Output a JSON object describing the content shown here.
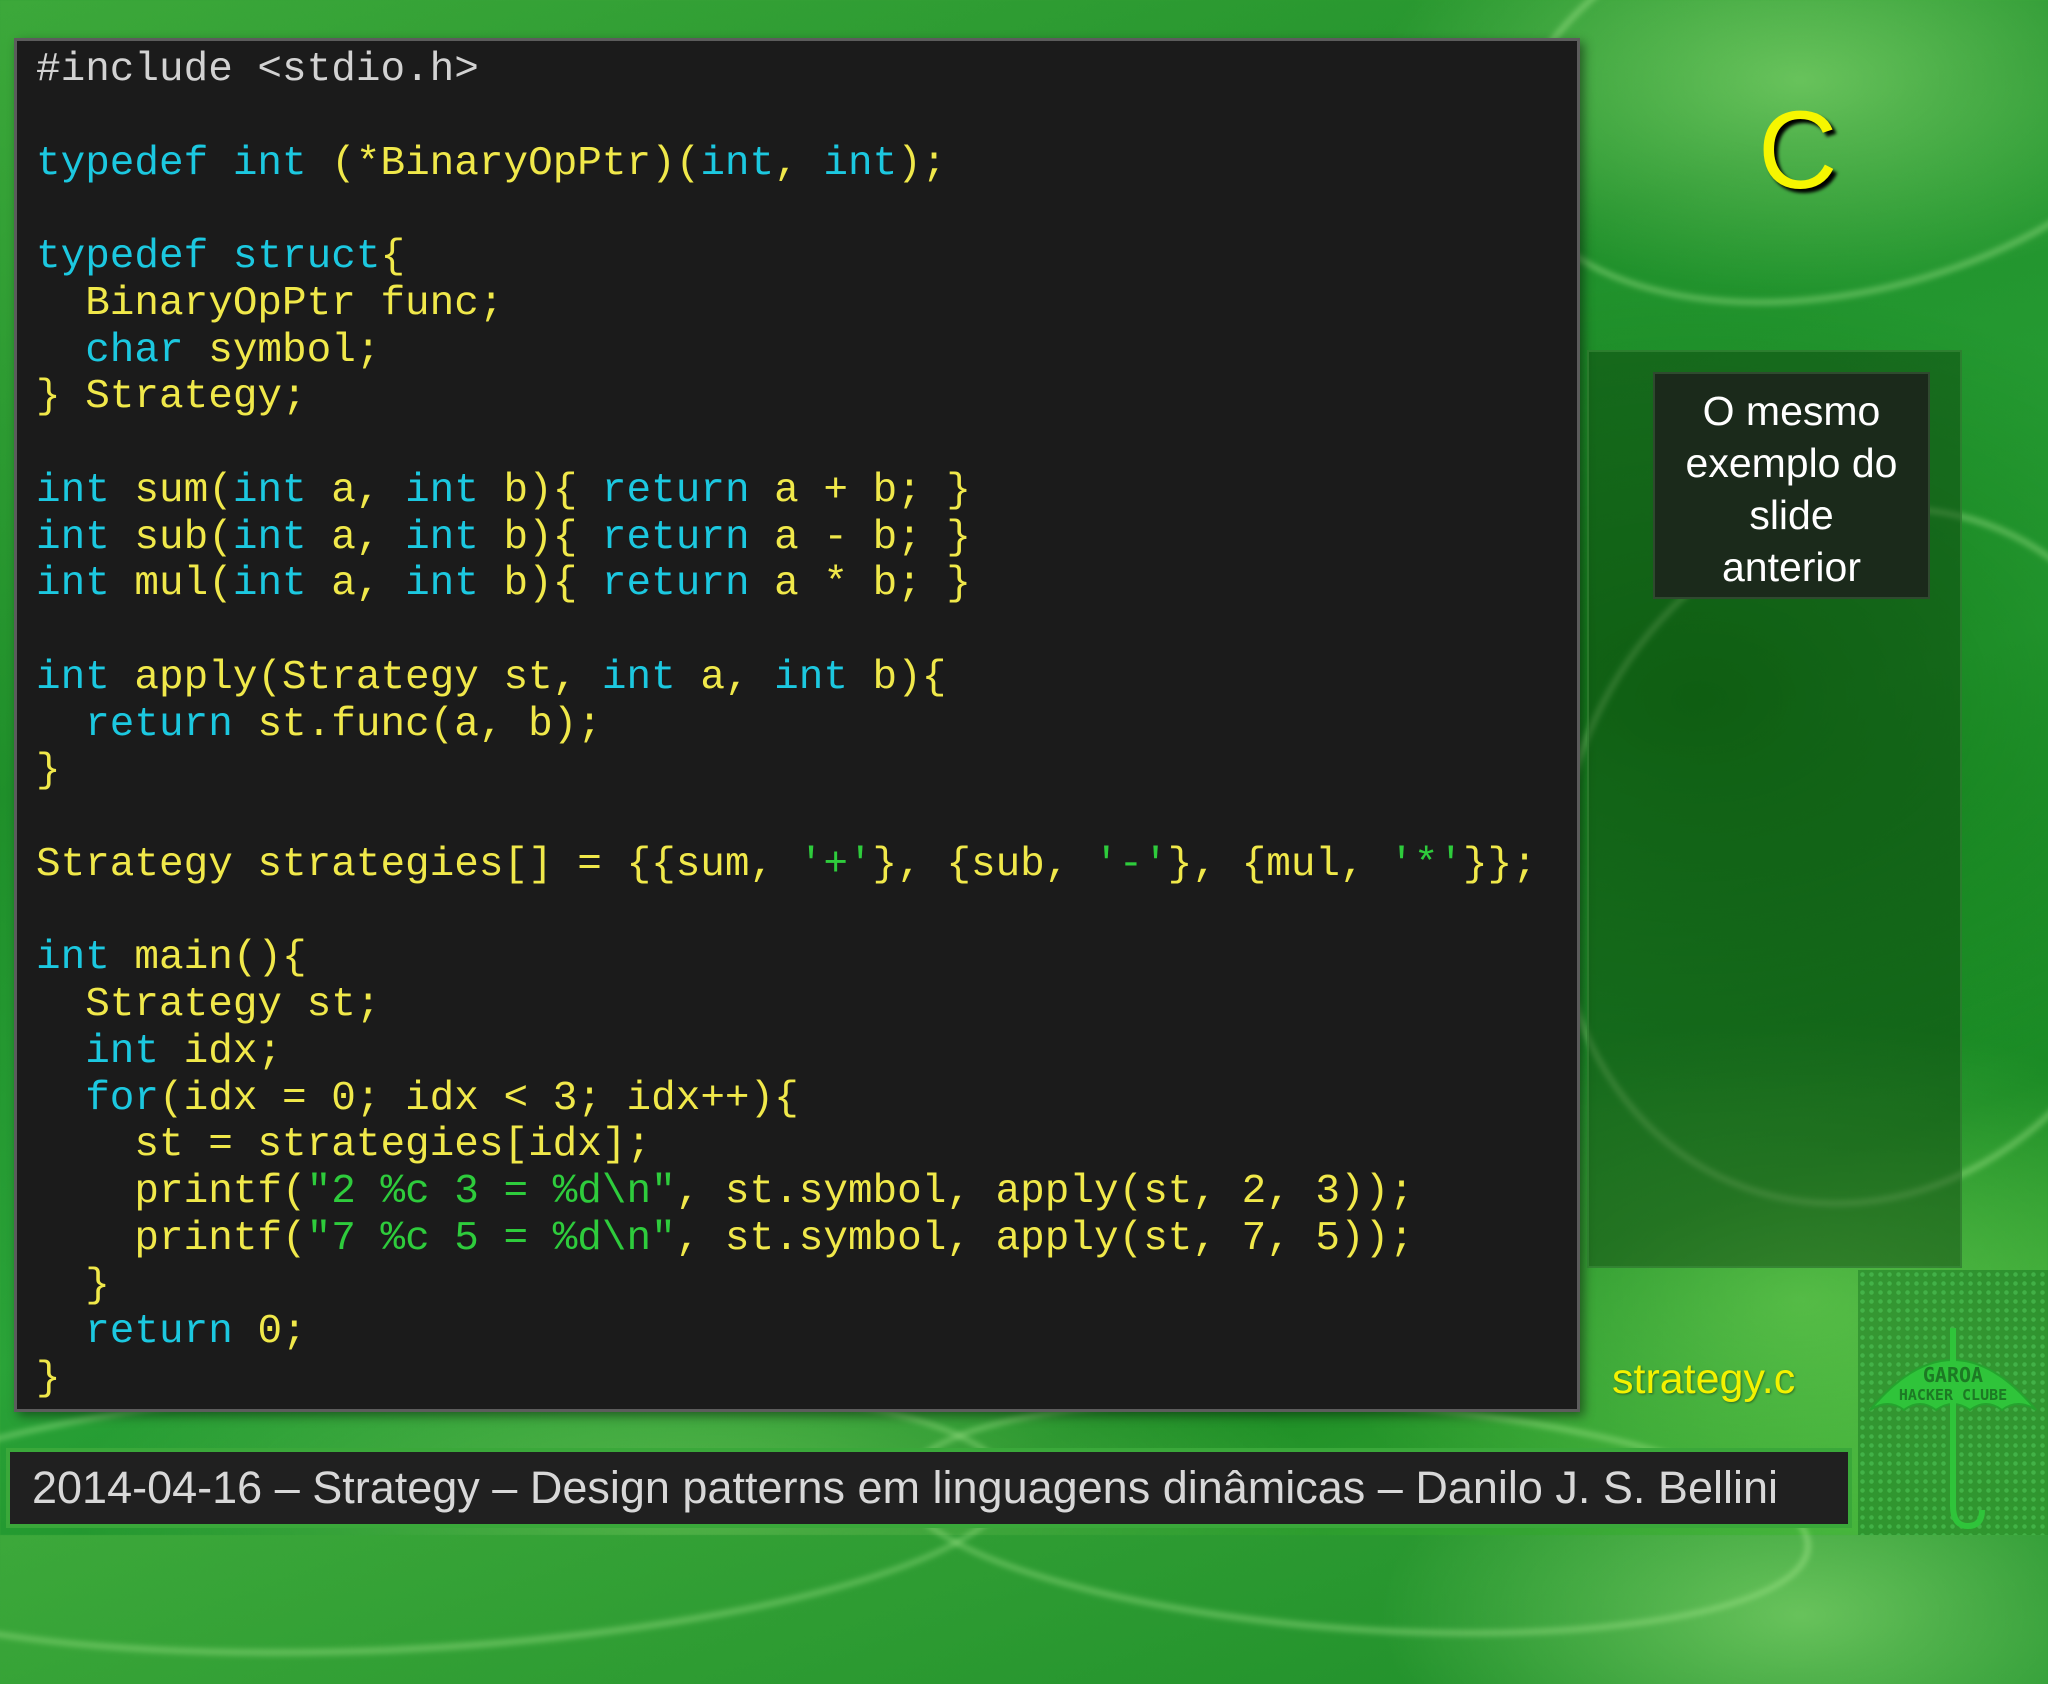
{
  "slide": {
    "language_title": "C",
    "note": [
      "O mesmo",
      "exemplo do",
      "slide",
      "anterior"
    ],
    "filename": "strategy.c",
    "footer": "2014-04-16 – Strategy – Design patterns em linguagens dinâmicas – Danilo J. S. Bellini",
    "logo_text": [
      "GAROA",
      "HACKER CLUBE"
    ]
  },
  "colors": {
    "keyword": "#1cc8e0",
    "identifier": "#f0e84a",
    "string": "#2ecc3c",
    "preprocessor": "#d2d2d2",
    "code_background": "#1b1b1b",
    "title": "#f6f600"
  },
  "code_lines": [
    [
      [
        "pp",
        "#include <stdio.h>"
      ]
    ],
    [],
    [
      [
        "kw",
        "typedef int"
      ],
      [
        "plain",
        " (*BinaryOpPtr)("
      ],
      [
        "kw",
        "int"
      ],
      [
        "plain",
        ", "
      ],
      [
        "kw",
        "int"
      ],
      [
        "plain",
        ");"
      ]
    ],
    [],
    [
      [
        "kw",
        "typedef struct"
      ],
      [
        "plain",
        "{"
      ]
    ],
    [
      [
        "plain",
        "  BinaryOpPtr func;"
      ]
    ],
    [
      [
        "kw",
        "  char"
      ],
      [
        "plain",
        " symbol;"
      ]
    ],
    [
      [
        "plain",
        "} Strategy;"
      ]
    ],
    [],
    [
      [
        "kw",
        "int"
      ],
      [
        "plain",
        " sum("
      ],
      [
        "kw",
        "int"
      ],
      [
        "plain",
        " a, "
      ],
      [
        "kw",
        "int"
      ],
      [
        "plain",
        " b){ "
      ],
      [
        "kw",
        "return"
      ],
      [
        "plain",
        " a + b; }"
      ]
    ],
    [
      [
        "kw",
        "int"
      ],
      [
        "plain",
        " sub("
      ],
      [
        "kw",
        "int"
      ],
      [
        "plain",
        " a, "
      ],
      [
        "kw",
        "int"
      ],
      [
        "plain",
        " b){ "
      ],
      [
        "kw",
        "return"
      ],
      [
        "plain",
        " a - b; }"
      ]
    ],
    [
      [
        "kw",
        "int"
      ],
      [
        "plain",
        " mul("
      ],
      [
        "kw",
        "int"
      ],
      [
        "plain",
        " a, "
      ],
      [
        "kw",
        "int"
      ],
      [
        "plain",
        " b){ "
      ],
      [
        "kw",
        "return"
      ],
      [
        "plain",
        " a * b; }"
      ]
    ],
    [],
    [
      [
        "kw",
        "int"
      ],
      [
        "plain",
        " apply(Strategy st, "
      ],
      [
        "kw",
        "int"
      ],
      [
        "plain",
        " a, "
      ],
      [
        "kw",
        "int"
      ],
      [
        "plain",
        " b){"
      ]
    ],
    [
      [
        "kw",
        "  return"
      ],
      [
        "plain",
        " st.func(a, b);"
      ]
    ],
    [
      [
        "plain",
        "}"
      ]
    ],
    [],
    [
      [
        "plain",
        "Strategy strategies[] = {{sum, "
      ],
      [
        "str",
        "'+'"
      ],
      [
        "plain",
        "}, {sub, "
      ],
      [
        "str",
        "'-'"
      ],
      [
        "plain",
        "}, {mul, "
      ],
      [
        "str",
        "'*'"
      ],
      [
        "plain",
        "}};"
      ]
    ],
    [],
    [
      [
        "kw",
        "int"
      ],
      [
        "plain",
        " main(){"
      ]
    ],
    [
      [
        "plain",
        "  Strategy st;"
      ]
    ],
    [
      [
        "kw",
        "  int"
      ],
      [
        "plain",
        " idx;"
      ]
    ],
    [
      [
        "kw",
        "  for"
      ],
      [
        "plain",
        "(idx = 0; idx < 3; idx++){"
      ]
    ],
    [
      [
        "plain",
        "    st = strategies[idx];"
      ]
    ],
    [
      [
        "plain",
        "    printf("
      ],
      [
        "str",
        "\"2 %c 3 = %d\\n\""
      ],
      [
        "plain",
        ", st.symbol, apply(st, 2, 3));"
      ]
    ],
    [
      [
        "plain",
        "    printf("
      ],
      [
        "str",
        "\"7 %c 5 = %d\\n\""
      ],
      [
        "plain",
        ", st.symbol, apply(st, 7, 5));"
      ]
    ],
    [
      [
        "plain",
        "  }"
      ]
    ],
    [
      [
        "kw",
        "  return"
      ],
      [
        "plain",
        " 0;"
      ]
    ],
    [
      [
        "plain",
        "}"
      ]
    ]
  ]
}
